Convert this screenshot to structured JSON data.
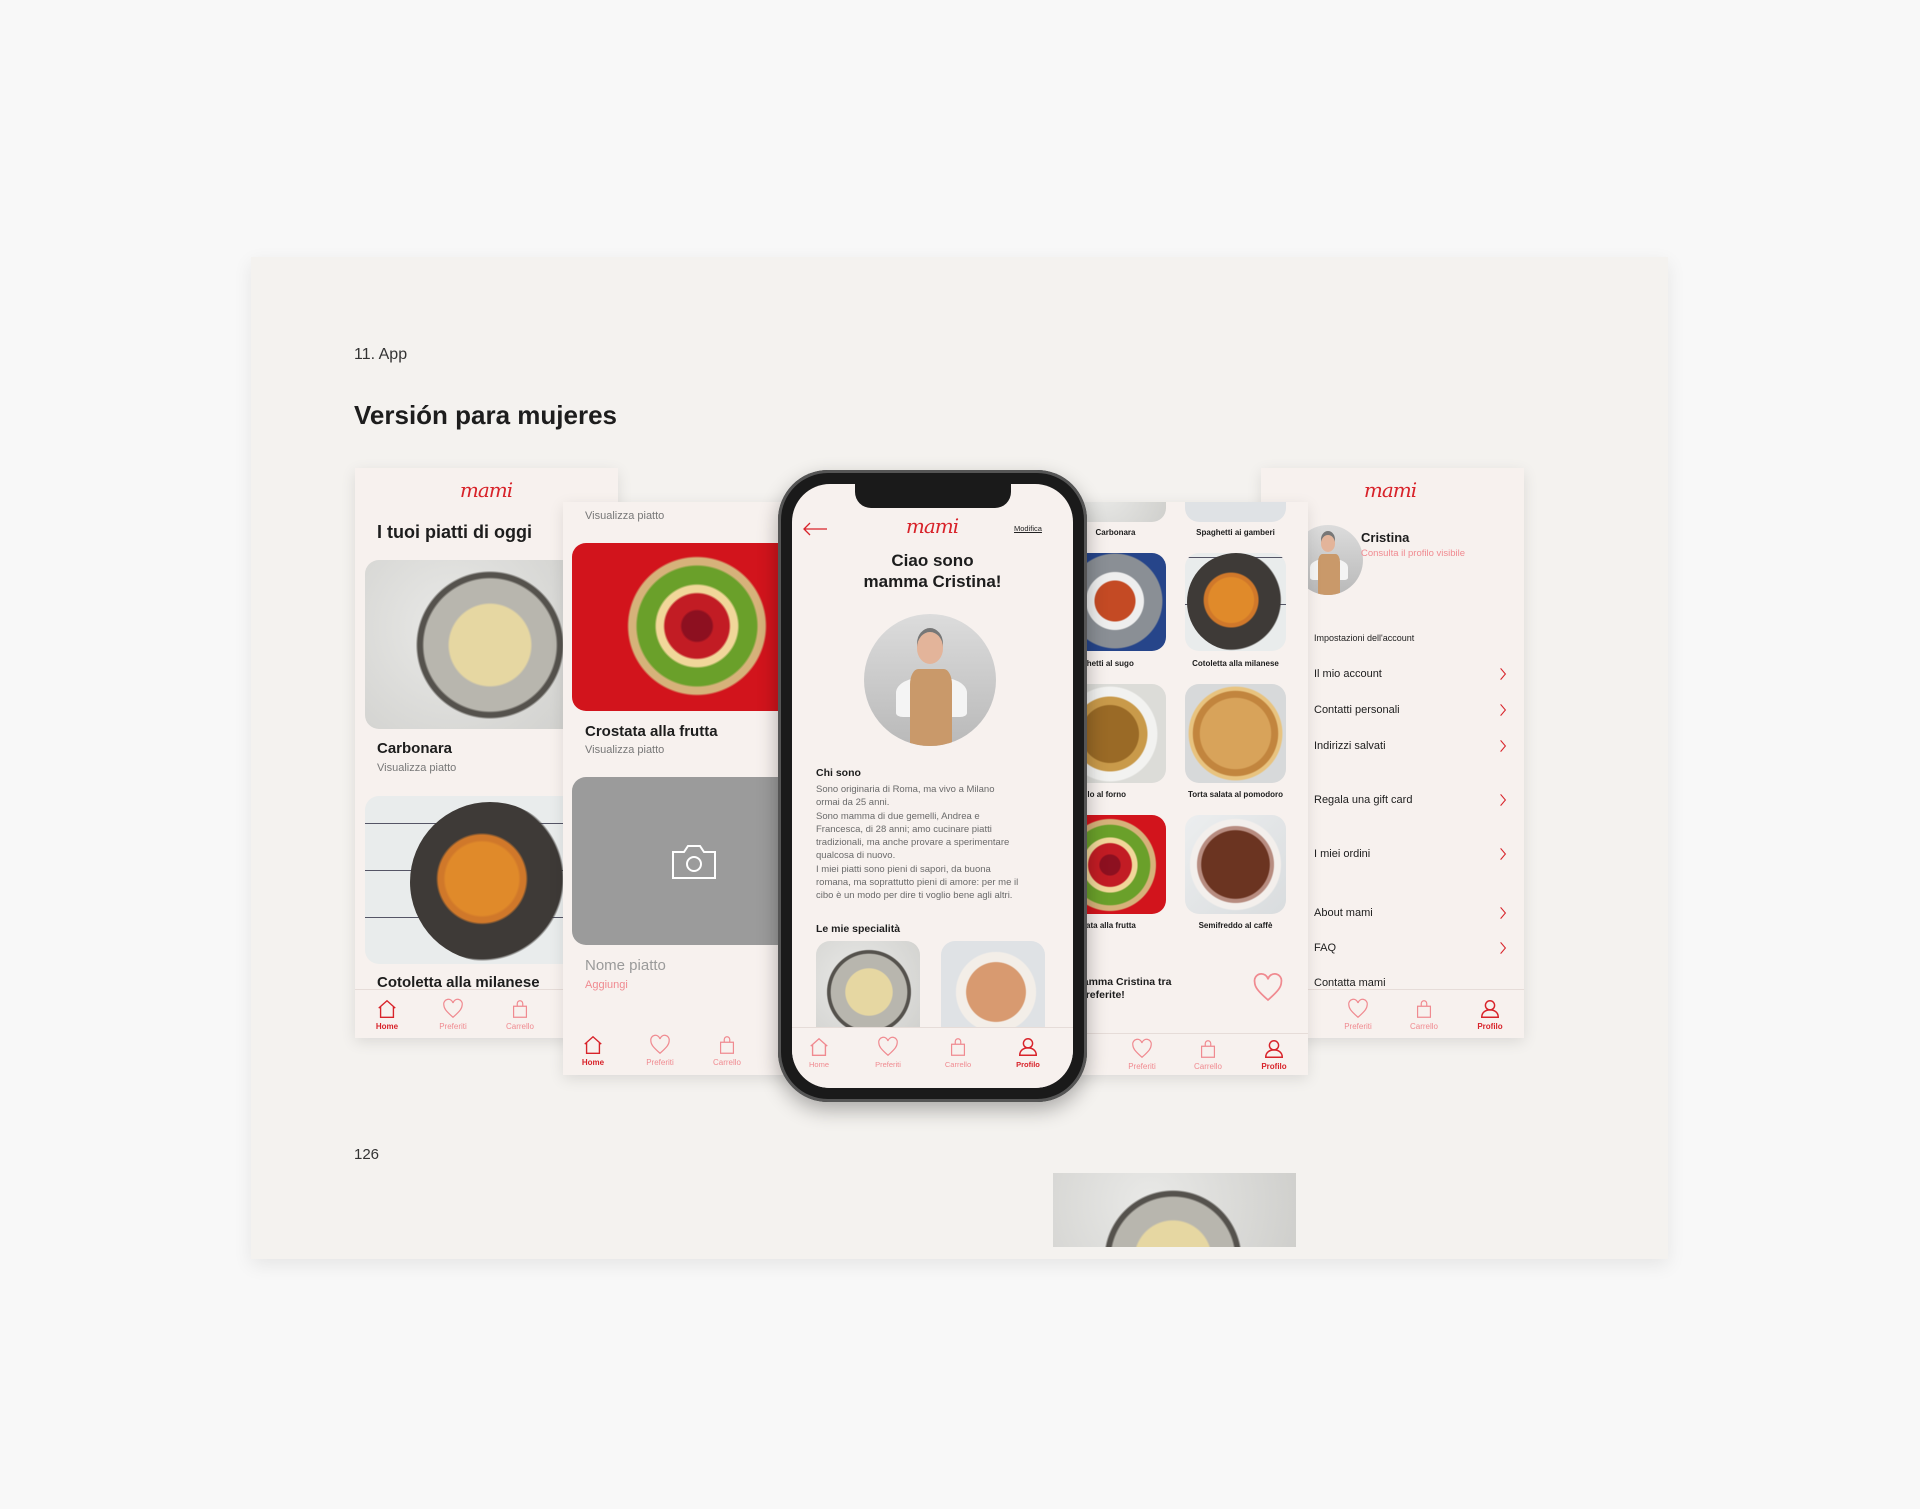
{
  "page": {
    "section_label": "11. App",
    "title": "Versión para mujeres",
    "page_number": "126"
  },
  "brand": {
    "logo": "mami",
    "accent": "#d8232a",
    "accent_light": "#f08a90"
  },
  "nav": {
    "home": "Home",
    "favorites": "Preferiti",
    "cart": "Carrello",
    "profile": "Profilo"
  },
  "screen_home": {
    "title": "I tuoi piatti di oggi",
    "dishes": [
      {
        "name": "Carbonara",
        "action": "Visualizza piatto"
      },
      {
        "name": "Cotoletta alla milanese"
      }
    ]
  },
  "screen_dishes": {
    "top_action": "Visualizza piatto",
    "dishes": [
      {
        "name": "Crostata alla frutta",
        "action": "Visualizza piatto"
      }
    ],
    "new_dish": {
      "placeholder_name": "Nome piatto",
      "action": "Aggiungi"
    }
  },
  "screen_profile_public": {
    "edit": "Modifica",
    "greeting_line1": "Ciao sono",
    "greeting_line2": "mamma Cristina!",
    "about_title": "Chi sono",
    "about_text": "Sono originaria di Roma, ma vivo a Milano\normai da 25 anni.\nSono mamma di due gemelli, Andrea e\nFrancesca, di 28 anni; amo cucinare piatti\ntradizionali, ma anche provare a sperimentare\nqualcosa di nuovo.\nI miei piatti sono pieni di sapori, da buona\nromana, ma soprattutto pieni di amore: per me il\ncibo è un modo per dire ti voglio bene agli altri.",
    "specialties_title": "Le mie specialità"
  },
  "screen_grid": {
    "dishes": [
      "Carbonara",
      "Spaghetti ai gamberi",
      "Spaghetti al sugo",
      "Cotoletta alla milanese",
      "Pollo al forno",
      "Torta salata al pomodoro",
      "Crostata alla frutta",
      "Semifreddo al caffè"
    ],
    "favorite_line1": "Aggiungi mamma Cristina tra",
    "favorite_line2": "le mamme preferite!"
  },
  "screen_account": {
    "name": "Cristina",
    "profile_link": "Consulta il profilo visibile",
    "section": "Impostazioni dell'account",
    "menu": [
      "Il mio account",
      "Contatti personali",
      "Indirizzi salvati",
      "Regala una gift card",
      "I miei ordini",
      "About mami",
      "FAQ",
      "Contatta mami"
    ]
  }
}
